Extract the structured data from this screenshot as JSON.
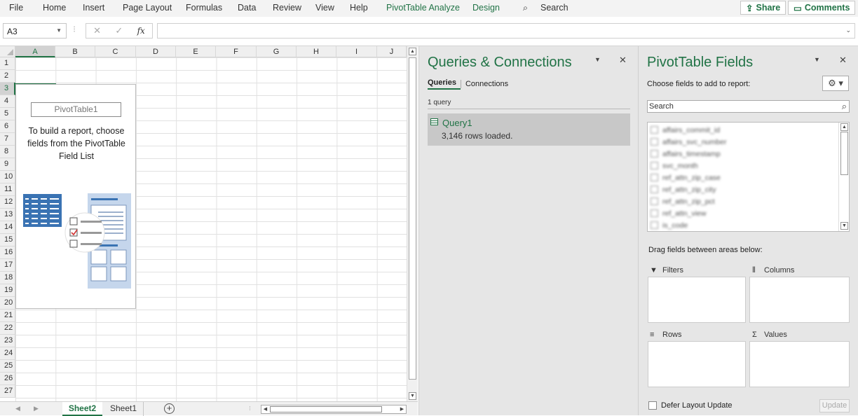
{
  "ribbon": {
    "tabs": [
      "File",
      "Home",
      "Insert",
      "Page Layout",
      "Formulas",
      "Data",
      "Review",
      "View",
      "Help",
      "PivotTable Analyze",
      "Design"
    ],
    "search_label": "Search",
    "share_label": "Share",
    "comments_label": "Comments",
    "accent_color": "#217346"
  },
  "formula_bar": {
    "name_box": "A3",
    "cancel_icon": "✕",
    "enter_icon": "✓",
    "fx_label": "fx",
    "formula_value": ""
  },
  "grid": {
    "columns": [
      "A",
      "B",
      "C",
      "D",
      "E",
      "F",
      "G",
      "H",
      "I",
      "J"
    ],
    "rows": [
      "1",
      "2",
      "3",
      "4",
      "5",
      "6",
      "7",
      "8",
      "9",
      "10",
      "11",
      "12",
      "13",
      "14",
      "15",
      "16",
      "17",
      "18",
      "19",
      "20",
      "21",
      "22",
      "23",
      "24",
      "25",
      "26",
      "27"
    ],
    "selected_column": "A",
    "selected_row": "3",
    "pivot": {
      "title": "PivotTable1",
      "message": "To build a report, choose fields from the PivotTable Field List"
    }
  },
  "sheets": {
    "tabs": [
      "Sheet2",
      "Sheet1"
    ],
    "active": "Sheet2",
    "add_label": "+"
  },
  "queries_panel": {
    "title": "Queries & Connections",
    "tab_queries": "Queries",
    "tab_connections": "Connections",
    "count": "1 query",
    "query": {
      "name": "Query1",
      "status": "3,146 rows loaded."
    }
  },
  "fields_panel": {
    "title": "PivotTable Fields",
    "choose_label": "Choose fields to add to report:",
    "search_placeholder": "Search",
    "fields": [
      "affairs_commit_id",
      "affairs_svc_number",
      "affairs_timestamp",
      "svc_month",
      "ref_attn_zip_case",
      "ref_attn_zip_city",
      "ref_attn_zip_pct",
      "ref_attn_view",
      "is_code"
    ],
    "drag_label": "Drag fields between areas below:",
    "areas": {
      "filters": "Filters",
      "columns": "Columns",
      "rows": "Rows",
      "values": "Values"
    },
    "defer_label": "Defer Layout Update",
    "update_label": "Update"
  }
}
